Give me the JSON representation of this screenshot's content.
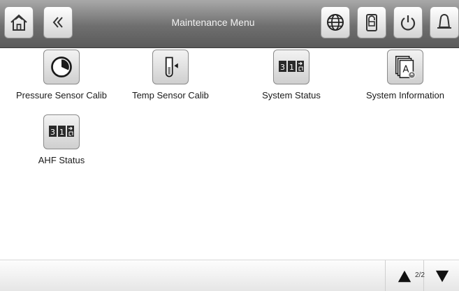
{
  "header": {
    "title": "Maintenance Menu",
    "buttons": [
      "home-icon",
      "back-icon",
      "globe-icon",
      "lock-icon",
      "power-icon",
      "bell-icon"
    ]
  },
  "tiles": [
    {
      "label": "Pressure Sensor Calib",
      "icon": "pressure-gauge-icon"
    },
    {
      "label": "Temp Sensor Calib",
      "icon": "thermometer-icon"
    },
    {
      "label": "System Status",
      "icon": "status-counter-icon"
    },
    {
      "label": "System Information",
      "icon": "documents-icon"
    },
    {
      "label": "AHF Status",
      "icon": "status-counter-icon"
    }
  ],
  "counter_digits": [
    "3",
    "1"
  ],
  "pagination": {
    "page": "2/2",
    "up_icon": "triangle-up-icon",
    "down_icon": "triangle-down-icon"
  }
}
